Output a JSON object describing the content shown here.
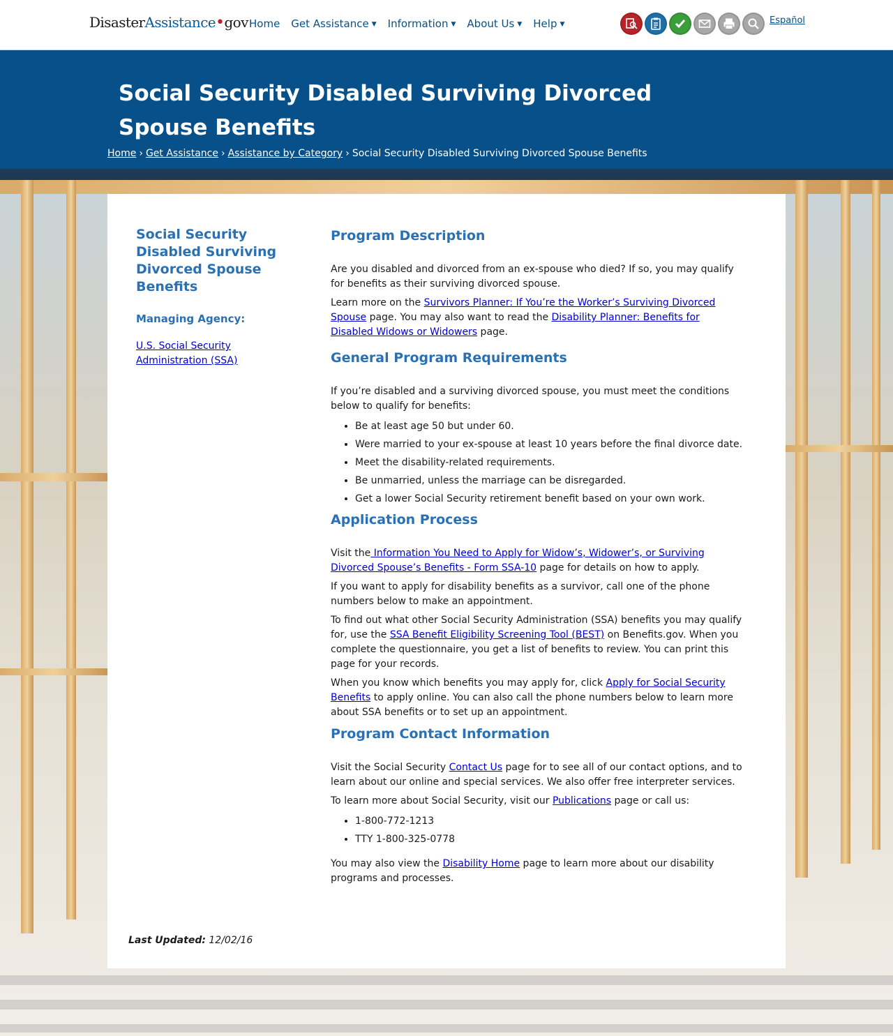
{
  "logo": {
    "part1": "Disaster",
    "part2": "Assistance",
    "dot": "•",
    "part3": "gov"
  },
  "nav": {
    "home": "Home",
    "get_assistance": "Get Assistance",
    "information": "Information",
    "about_us": "About Us",
    "help": "Help"
  },
  "toolbar_icons": [
    {
      "name": "apply-online-icon",
      "color": "#b5252a"
    },
    {
      "name": "check-status-icon",
      "color": "#1f6fa6"
    },
    {
      "name": "checklist-icon",
      "color": "#3a9e3a"
    },
    {
      "name": "email-icon",
      "color": "#a8a8a8"
    },
    {
      "name": "print-icon",
      "color": "#a8a8a8"
    },
    {
      "name": "search-icon",
      "color": "#a8a8a8"
    }
  ],
  "language_link": "Español",
  "page_title": "Social Security Disabled Surviving Divorced Spouse Benefits",
  "breadcrumb": {
    "home": "Home",
    "get_assistance": "Get Assistance",
    "by_category": "Assistance by Category",
    "current": "Social Security Disabled Surviving Divorced Spouse Benefits"
  },
  "sidebar": {
    "title": "Social Security Disabled Surviving Divorced Spouse Benefits",
    "agency_label": "Managing Agency:",
    "agency_link": "U.S. Social Security Administration (SSA)"
  },
  "sections": {
    "description": {
      "heading": "Program Description",
      "p1": "Are you disabled and divorced from an ex-spouse who died? If so, you may qualify for benefits as their surviving divorced spouse.",
      "p2_pre": "Learn more on the ",
      "p2_link1": "Survivors Planner: If You’re the Worker’s Surviving Divorced Spouse",
      "p2_mid": " page. You may also want to read the ",
      "p2_link2": "Disability Planner: Benefits for Disabled Widows or Widowers",
      "p2_post": " page."
    },
    "requirements": {
      "heading": "General Program Requirements",
      "intro": "If you’re disabled and a surviving divorced spouse, you must meet the conditions below to qualify for benefits:",
      "items": [
        "Be at least age 50 but under 60.",
        "Were married to your ex-spouse at least 10 years before the final divorce date.",
        "Meet the disability-related requirements.",
        "Be unmarried, unless the marriage can be disregarded.",
        "Get a lower Social Security retirement benefit based on your own work."
      ]
    },
    "application": {
      "heading": "Application Process",
      "p1_pre": "Visit the",
      "p1_link": " Information You Need to Apply for Widow’s, Widower’s, or Surviving Divorced Spouse’s Benefits - Form SSA-10",
      "p1_post": " page for details on how to apply.",
      "p2": "If you want to apply for disability benefits as a survivor, call one of the phone numbers below to make an appointment.",
      "p3_pre": "To find out what other Social Security Administration (SSA) benefits you may qualify for, use the ",
      "p3_link": "SSA Benefit Eligibility Screening Tool (BEST)",
      "p3_post": " on Benefits.gov. When you complete the questionnaire, you get a list of benefits to review. You can print this page for your records.",
      "p4_pre": "When you know which benefits you may apply for, click ",
      "p4_link": "Apply for Social Security Benefits",
      "p4_post": " to apply online. You can also call the phone numbers below to learn more about SSA benefits or to set up an appointment."
    },
    "contact": {
      "heading": "Program Contact Information",
      "p1_pre": "Visit the Social Security ",
      "p1_link": "Contact Us",
      "p1_post": " page for to see all of our contact options, and to learn about our online and special services. We also offer free interpreter services.",
      "p2_pre": "To learn more about Social Security, visit our ",
      "p2_link": "Publications",
      "p2_post": " page or call us:",
      "phones": [
        "1-800-772-1213",
        "TTY 1-800-325-0778"
      ],
      "p3_pre": "You may also view the ",
      "p3_link": "Disability Home",
      "p3_post": " page to learn more about our disability programs and processes."
    }
  },
  "last_updated": {
    "label": "Last Updated:",
    "value": "12/02/16"
  }
}
